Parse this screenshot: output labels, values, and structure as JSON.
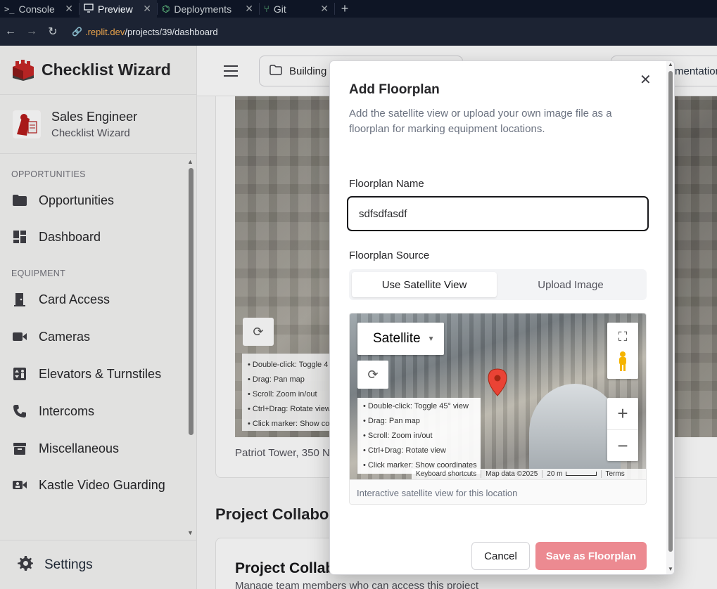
{
  "browser": {
    "tabs": [
      {
        "label": "Console",
        "icon": "terminal-icon"
      },
      {
        "label": "Preview",
        "icon": "monitor-icon"
      },
      {
        "label": "Deployments",
        "icon": "deployments-icon"
      },
      {
        "label": "Git",
        "icon": "git-icon"
      }
    ],
    "url_domain": ".replit.dev",
    "url_path": "/projects/39/dashboard"
  },
  "sidebar": {
    "brand": "Checklist Wizard",
    "profile_name": "Sales Engineer",
    "profile_role": "Checklist Wizard",
    "section_opportunities": "OPPORTUNITIES",
    "section_equipment": "EQUIPMENT",
    "items": [
      {
        "label": "Opportunities",
        "icon": "folder-icon"
      },
      {
        "label": "Dashboard",
        "icon": "dashboard-icon"
      },
      {
        "label": "Card Access",
        "icon": "door-icon"
      },
      {
        "label": "Cameras",
        "icon": "video-camera-icon"
      },
      {
        "label": "Elevators & Turnstiles",
        "icon": "elevator-icon"
      },
      {
        "label": "Intercoms",
        "icon": "phone-icon"
      },
      {
        "label": "Miscellaneous",
        "icon": "archive-icon"
      },
      {
        "label": "Kastle Video Guarding",
        "icon": "video-guard-icon"
      }
    ],
    "settings": "Settings"
  },
  "main": {
    "crumb": "Building",
    "right_btn": "mentation",
    "bg_help": [
      "• Double-click: Toggle 4",
      "• Drag: Pan map",
      "• Scroll: Zoom in/out",
      "• Ctrl+Drag: Rotate view",
      "• Click marker: Show coo"
    ],
    "address": "Patriot Tower, 350 N",
    "collab_heading": "Project Collabo",
    "collab_title": "Project Collab",
    "collab_sub": "Manage team members who can access this project"
  },
  "modal": {
    "title": "Add Floorplan",
    "description": "Add the satellite view or upload your own image file as a floorplan for marking equipment locations.",
    "name_label": "Floorplan Name",
    "name_value": "sdfsdfasdf",
    "source_label": "Floorplan Source",
    "source_options": [
      "Use Satellite View",
      "Upload Image"
    ],
    "source_selected": "Use Satellite View",
    "map": {
      "type_select": "Satellite",
      "help_lines": [
        "• Double-click: Toggle 45° view",
        "• Drag: Pan map",
        "• Scroll: Zoom in/out",
        "• Ctrl+Drag: Rotate view",
        "• Click marker: Show coordinates"
      ],
      "attribution": [
        "Keyboard shortcuts",
        "Map data ©2025",
        "20 m",
        "Terms"
      ],
      "caption": "Interactive satellite view for this location"
    },
    "cancel": "Cancel",
    "save": "Save as Floorplan"
  }
}
